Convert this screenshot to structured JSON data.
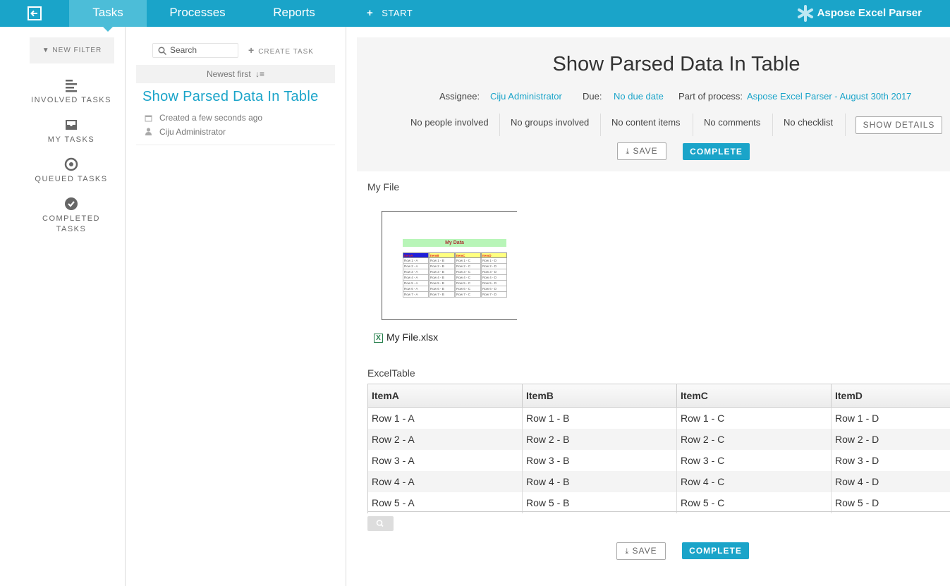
{
  "app": {
    "nav_tabs": [
      {
        "label": "Tasks",
        "active": true
      },
      {
        "label": "Processes",
        "active": false
      },
      {
        "label": "Reports",
        "active": false
      }
    ],
    "start_label": "START",
    "brand_name": "Aspose Excel Parser",
    "accent_color": "#1aa4c9"
  },
  "sidebar": {
    "new_filter_label": "NEW FILTER",
    "items": [
      {
        "label": "INVOLVED TASKS",
        "icon": "list-icon"
      },
      {
        "label": "MY TASKS",
        "icon": "inbox-icon"
      },
      {
        "label": "QUEUED TASKS",
        "icon": "target-icon"
      },
      {
        "label": "COMPLETED TASKS",
        "icon": "check-circle-icon"
      }
    ]
  },
  "tasklist": {
    "search_placeholder": "Search",
    "create_task_label": "CREATE TASK",
    "sort_label": "Newest first",
    "tasks": [
      {
        "title": "Show Parsed Data In Table",
        "created": "Created a few seconds ago",
        "assignee": "Ciju Administrator"
      }
    ]
  },
  "task": {
    "title": "Show Parsed Data In Table",
    "assignee_label": "Assignee:",
    "assignee": "Ciju Administrator",
    "due_label": "Due:",
    "due": "No due date",
    "process_label": "Part of process:",
    "process": "Aspose Excel Parser - August 30th 2017",
    "stats": [
      "No people involved",
      "No groups involved",
      "No content items",
      "No comments",
      "No checklist"
    ],
    "show_details_label": "SHOW DETAILS",
    "save_label": "SAVE",
    "complete_label": "COMPLETE"
  },
  "form": {
    "file_section_label": "My File",
    "file_name": "My File.xlsx",
    "thumbnail": {
      "title": "My Data",
      "headers": [
        "ItemA",
        "ItemB",
        "ItemC",
        "ItemD"
      ],
      "rows": [
        [
          "Row 1 - A",
          "Row 1 - B",
          "Row 1 - C",
          "Row 1 - D"
        ],
        [
          "Row 2 - A",
          "Row 2 - B",
          "Row 2 - C",
          "Row 2 - D"
        ],
        [
          "Row 3 - A",
          "Row 3 - B",
          "Row 3 - C",
          "Row 3 - D"
        ],
        [
          "Row 4 - A",
          "Row 4 - B",
          "Row 4 - C",
          "Row 4 - D"
        ],
        [
          "Row 5 - A",
          "Row 5 - B",
          "Row 5 - C",
          "Row 5 - D"
        ],
        [
          "Row 6 - A",
          "Row 6 - B",
          "Row 6 - C",
          "Row 6 - D"
        ],
        [
          "Row 7 - A",
          "Row 7 - B",
          "Row 7 - C",
          "Row 7 - D"
        ]
      ]
    },
    "table_section_label": "ExcelTable",
    "table": {
      "columns": [
        "ItemA",
        "ItemB",
        "ItemC",
        "ItemD"
      ],
      "rows": [
        [
          "Row 1 - A",
          "Row 1 - B",
          "Row 1 - C",
          "Row 1 - D"
        ],
        [
          "Row 2 - A",
          "Row 2 - B",
          "Row 2 - C",
          "Row 2 - D"
        ],
        [
          "Row 3 - A",
          "Row 3 - B",
          "Row 3 - C",
          "Row 3 - D"
        ],
        [
          "Row 4 - A",
          "Row 4 - B",
          "Row 4 - C",
          "Row 4 - D"
        ],
        [
          "Row 5 - A",
          "Row 5 - B",
          "Row 5 - C",
          "Row 5 - D"
        ]
      ]
    },
    "save_label": "SAVE",
    "complete_label": "COMPLETE"
  }
}
